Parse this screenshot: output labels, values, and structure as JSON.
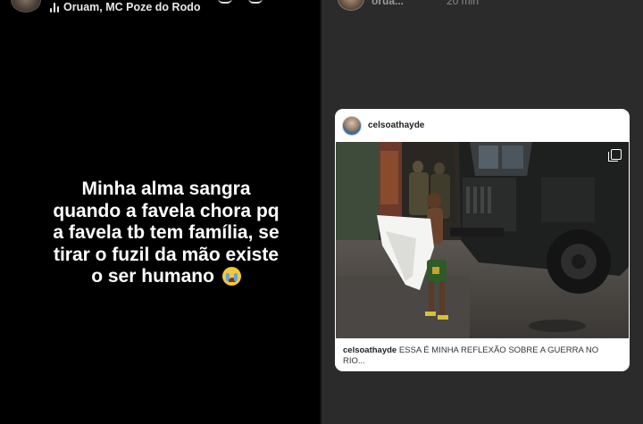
{
  "left_story": {
    "music_attribution": "Oruam, MC Poze do Rodo",
    "caption_lines": [
      "Minha alma sangra",
      "quando a favela chora pq",
      "a favela tb tem família, se",
      "tirar o fuzil da mão existe",
      "o ser humano"
    ],
    "caption_emoji": "loudly-crying-face-emoji"
  },
  "right_story": {
    "header_username": "orua...",
    "header_time": "20 min",
    "post": {
      "username": "celsoathayde",
      "caption_user": "celsoathayde",
      "caption_text": "ESSA É MINHA REFLEXÃO SOBRE A GUERRA NO RIO..."
    }
  },
  "colors": {
    "left_background": "#000000",
    "right_background": "#2b2b2b",
    "card_background": "#ffffff"
  }
}
